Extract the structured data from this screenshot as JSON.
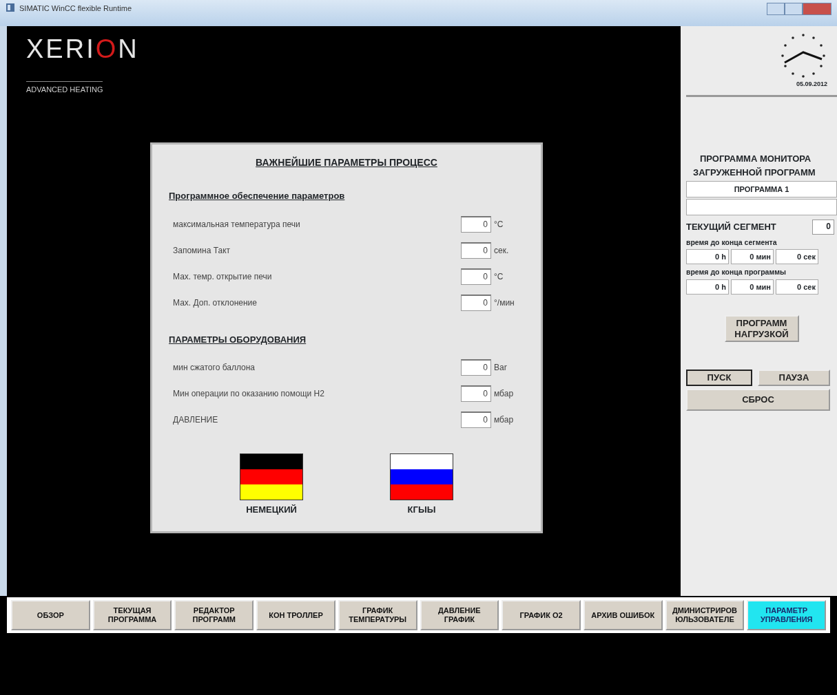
{
  "window": {
    "title": "SIMATIC WinCC flexible Runtime"
  },
  "logo": {
    "name": "XERION",
    "tagline": "ADVANCED HEATING"
  },
  "dialog": {
    "title": "ВАЖНЕЙШИЕ ПАРАМЕТРЫ ПРОЦЕСС",
    "sections": [
      {
        "heading": "Программное обеспечение параметров",
        "rows": [
          {
            "label": "максимальная температура печи",
            "value": "0",
            "unit": "°C"
          },
          {
            "label": "Запомина Такт",
            "value": "0",
            "unit": "сек."
          },
          {
            "label": "Мах. темр. открытие печи",
            "value": "0",
            "unit": "°C"
          },
          {
            "label": "Мах. Доп. отклонение",
            "value": "0",
            "unit": "°/мин"
          }
        ]
      },
      {
        "heading": "ПАРАМЕТРЫ ОБОРУДОВАНИЯ",
        "rows": [
          {
            "label": "мин сжатого баллона",
            "value": "0",
            "unit": "Bar"
          },
          {
            "label": "Мин операции по оказанию помощи H2",
            "value": "0",
            "unit": "мбар"
          },
          {
            "label": "ДАВЛЕНИЕ",
            "value": "0",
            "unit": "мбар"
          }
        ]
      }
    ],
    "languages": [
      {
        "label": "НЕМЕЦКИЙ",
        "kind": "german"
      },
      {
        "label": "КГЫЫ",
        "kind": "russian"
      }
    ]
  },
  "monitor": {
    "date": "05.09.2012",
    "title_lines": [
      "ПРОГРАММА МОНИТОРА",
      "ЗАГРУЖЕННОЙ ПРОГРАММ"
    ],
    "program": "ПРОГРАММА 1",
    "segment_label": "ТЕКУЩИЙ СЕГМЕНТ",
    "segment_value": "0",
    "timers": [
      {
        "label": "время до конца сегмента",
        "fields": [
          {
            "value": "0",
            "unit": "h"
          },
          {
            "value": "0",
            "unit": "мин"
          },
          {
            "value": "0",
            "unit": "сек"
          }
        ]
      },
      {
        "label": "время до конца программы",
        "fields": [
          {
            "value": "0",
            "unit": "h"
          },
          {
            "value": "0",
            "unit": "мин"
          },
          {
            "value": "0",
            "unit": "сек"
          }
        ]
      }
    ],
    "load_button": "ПРОГРАММ НАГРУЗКОЙ",
    "controls": [
      {
        "label": "ПУСК",
        "selected": true
      },
      {
        "label": "ПАУЗА",
        "selected": false
      }
    ],
    "reset_button": "СБРОС"
  },
  "nav": [
    {
      "label": "ОБЗОР",
      "selected": false
    },
    {
      "label": "ТЕКУЩАЯ ПРОГРАММА",
      "selected": false
    },
    {
      "label": "РЕДАКТОР ПРОГРАММ",
      "selected": false
    },
    {
      "label": "КОН ТРОЛЛЕР",
      "selected": false
    },
    {
      "label": "ГРАФИК ТЕМПЕРАТУРЫ",
      "selected": false
    },
    {
      "label": "ДАВЛЕНИЕ ГРАФИК",
      "selected": false
    },
    {
      "label": "ГРАФИК O2",
      "selected": false
    },
    {
      "label": "АРХИВ ОШИБОК",
      "selected": false
    },
    {
      "label": "ДМИНИСТРИРОВ ЮЛЬЗОВАТЕЛЕ",
      "selected": false
    },
    {
      "label": "ПАРАМЕТР УПРАВЛЕНИЯ",
      "selected": true
    }
  ]
}
